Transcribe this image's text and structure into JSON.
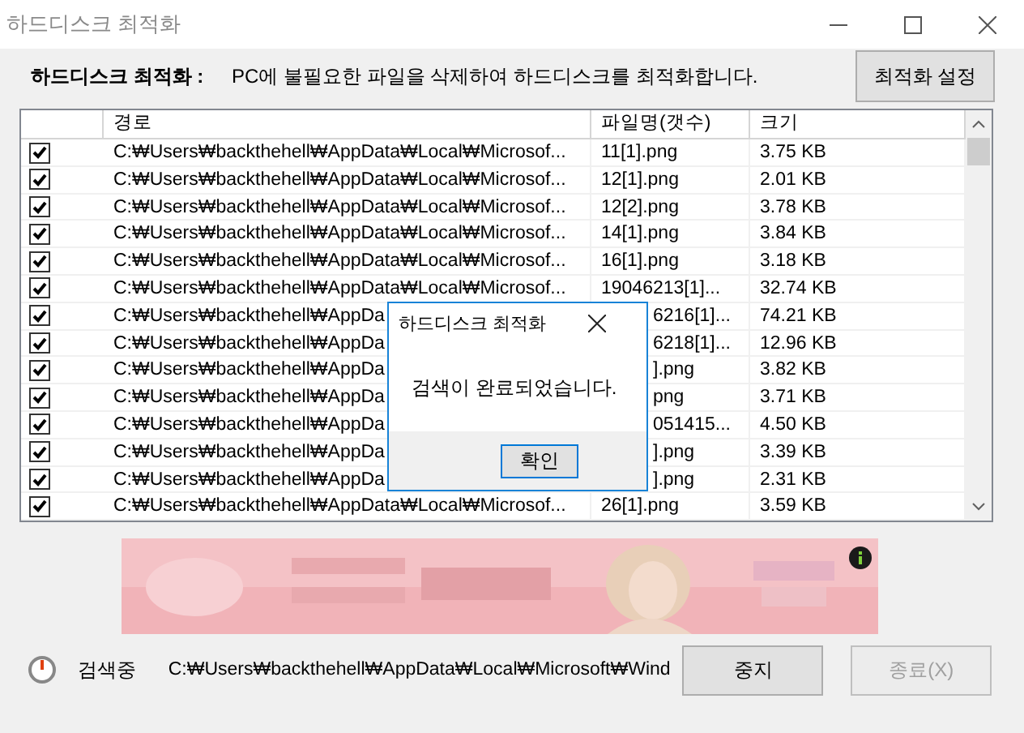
{
  "window": {
    "title": "하드디스크 최적화"
  },
  "header": {
    "label": "하드디스크 최적화 :",
    "description": "PC에 불필요한 파일을 삭제하여 하드디스크를 최적화합니다.",
    "settings_button": "최적화 설정"
  },
  "table": {
    "columns": [
      "경로",
      "파일명(갯수)",
      "크기"
    ],
    "rows": [
      {
        "checked": true,
        "path": "C:₩Users₩backthehell₩AppData₩Local₩Microsof...",
        "name": "11[1].png",
        "size": "3.75 KB"
      },
      {
        "checked": true,
        "path": "C:₩Users₩backthehell₩AppData₩Local₩Microsof...",
        "name": "12[1].png",
        "size": "2.01 KB"
      },
      {
        "checked": true,
        "path": "C:₩Users₩backthehell₩AppData₩Local₩Microsof...",
        "name": "12[2].png",
        "size": "3.78 KB"
      },
      {
        "checked": true,
        "path": "C:₩Users₩backthehell₩AppData₩Local₩Microsof...",
        "name": "14[1].png",
        "size": "3.84 KB"
      },
      {
        "checked": true,
        "path": "C:₩Users₩backthehell₩AppData₩Local₩Microsof...",
        "name": "16[1].png",
        "size": "3.18 KB"
      },
      {
        "checked": true,
        "path": "C:₩Users₩backthehell₩AppData₩Local₩Microsof...",
        "name": "19046213[1]...",
        "size": "32.74 KB"
      },
      {
        "checked": true,
        "path": "C:₩Users₩backthehell₩AppDa",
        "name": "6216[1]...",
        "size": "74.21 KB"
      },
      {
        "checked": true,
        "path": "C:₩Users₩backthehell₩AppDa",
        "name": "6218[1]...",
        "size": "12.96 KB"
      },
      {
        "checked": true,
        "path": "C:₩Users₩backthehell₩AppDa",
        "name": "].png",
        "size": "3.82 KB"
      },
      {
        "checked": true,
        "path": "C:₩Users₩backthehell₩AppDa",
        "name": "png",
        "size": "3.71 KB"
      },
      {
        "checked": true,
        "path": "C:₩Users₩backthehell₩AppDa",
        "name": "051415...",
        "size": "4.50 KB"
      },
      {
        "checked": true,
        "path": "C:₩Users₩backthehell₩AppDa",
        "name": "].png",
        "size": "3.39 KB"
      },
      {
        "checked": true,
        "path": "C:₩Users₩backthehell₩AppDa",
        "name": "].png",
        "size": "2.31 KB"
      },
      {
        "checked": true,
        "path": "C:₩Users₩backthehell₩AppData₩Local₩Microsof...",
        "name": "26[1].png",
        "size": "3.59 KB"
      }
    ]
  },
  "status": {
    "label": "검색중",
    "path": "C:₩Users₩backthehell₩AppData₩Local₩Microsoft₩Wind"
  },
  "buttons": [
    {
      "label": "중지",
      "disabled": false
    },
    {
      "label": "종료(X)",
      "disabled": true
    }
  ],
  "dialog": {
    "title": "하드디스크 최적화",
    "message": "검색이 완료되었습니다.",
    "button": "확인"
  }
}
